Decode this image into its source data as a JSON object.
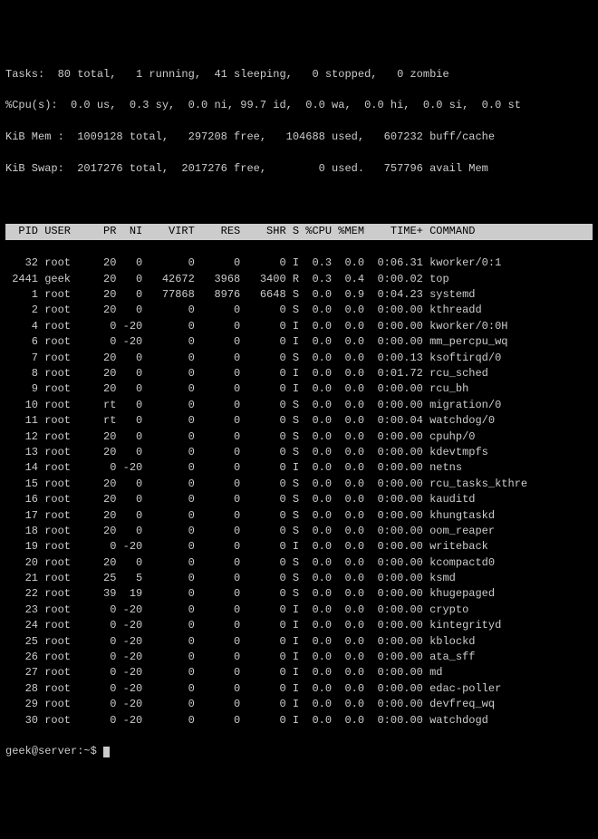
{
  "summary": {
    "tasks_line": "Tasks:  80 total,   1 running,  41 sleeping,   0 stopped,   0 zombie",
    "cpu_line": "%Cpu(s):  0.0 us,  0.3 sy,  0.0 ni, 99.7 id,  0.0 wa,  0.0 hi,  0.0 si,  0.0 st",
    "mem_line": "KiB Mem :  1009128 total,   297208 free,   104688 used,   607232 buff/cache",
    "swap_line": "KiB Swap:  2017276 total,  2017276 free,        0 used.   757796 avail Mem"
  },
  "columns": [
    "PID",
    "USER",
    "PR",
    "NI",
    "VIRT",
    "RES",
    "SHR",
    "S",
    "%CPU",
    "%MEM",
    "TIME+",
    "COMMAND"
  ],
  "processes": [
    {
      "pid": 32,
      "user": "root",
      "pr": "20",
      "ni": "0",
      "virt": "0",
      "res": "0",
      "shr": "0",
      "s": "I",
      "cpu": "0.3",
      "mem": "0.0",
      "time": "0:06.31",
      "cmd": "kworker/0:1"
    },
    {
      "pid": 2441,
      "user": "geek",
      "pr": "20",
      "ni": "0",
      "virt": "42672",
      "res": "3968",
      "shr": "3400",
      "s": "R",
      "cpu": "0.3",
      "mem": "0.4",
      "time": "0:00.02",
      "cmd": "top"
    },
    {
      "pid": 1,
      "user": "root",
      "pr": "20",
      "ni": "0",
      "virt": "77868",
      "res": "8976",
      "shr": "6648",
      "s": "S",
      "cpu": "0.0",
      "mem": "0.9",
      "time": "0:04.23",
      "cmd": "systemd"
    },
    {
      "pid": 2,
      "user": "root",
      "pr": "20",
      "ni": "0",
      "virt": "0",
      "res": "0",
      "shr": "0",
      "s": "S",
      "cpu": "0.0",
      "mem": "0.0",
      "time": "0:00.00",
      "cmd": "kthreadd"
    },
    {
      "pid": 4,
      "user": "root",
      "pr": "0",
      "ni": "-20",
      "virt": "0",
      "res": "0",
      "shr": "0",
      "s": "I",
      "cpu": "0.0",
      "mem": "0.0",
      "time": "0:00.00",
      "cmd": "kworker/0:0H"
    },
    {
      "pid": 6,
      "user": "root",
      "pr": "0",
      "ni": "-20",
      "virt": "0",
      "res": "0",
      "shr": "0",
      "s": "I",
      "cpu": "0.0",
      "mem": "0.0",
      "time": "0:00.00",
      "cmd": "mm_percpu_wq"
    },
    {
      "pid": 7,
      "user": "root",
      "pr": "20",
      "ni": "0",
      "virt": "0",
      "res": "0",
      "shr": "0",
      "s": "S",
      "cpu": "0.0",
      "mem": "0.0",
      "time": "0:00.13",
      "cmd": "ksoftirqd/0"
    },
    {
      "pid": 8,
      "user": "root",
      "pr": "20",
      "ni": "0",
      "virt": "0",
      "res": "0",
      "shr": "0",
      "s": "I",
      "cpu": "0.0",
      "mem": "0.0",
      "time": "0:01.72",
      "cmd": "rcu_sched"
    },
    {
      "pid": 9,
      "user": "root",
      "pr": "20",
      "ni": "0",
      "virt": "0",
      "res": "0",
      "shr": "0",
      "s": "I",
      "cpu": "0.0",
      "mem": "0.0",
      "time": "0:00.00",
      "cmd": "rcu_bh"
    },
    {
      "pid": 10,
      "user": "root",
      "pr": "rt",
      "ni": "0",
      "virt": "0",
      "res": "0",
      "shr": "0",
      "s": "S",
      "cpu": "0.0",
      "mem": "0.0",
      "time": "0:00.00",
      "cmd": "migration/0"
    },
    {
      "pid": 11,
      "user": "root",
      "pr": "rt",
      "ni": "0",
      "virt": "0",
      "res": "0",
      "shr": "0",
      "s": "S",
      "cpu": "0.0",
      "mem": "0.0",
      "time": "0:00.04",
      "cmd": "watchdog/0"
    },
    {
      "pid": 12,
      "user": "root",
      "pr": "20",
      "ni": "0",
      "virt": "0",
      "res": "0",
      "shr": "0",
      "s": "S",
      "cpu": "0.0",
      "mem": "0.0",
      "time": "0:00.00",
      "cmd": "cpuhp/0"
    },
    {
      "pid": 13,
      "user": "root",
      "pr": "20",
      "ni": "0",
      "virt": "0",
      "res": "0",
      "shr": "0",
      "s": "S",
      "cpu": "0.0",
      "mem": "0.0",
      "time": "0:00.00",
      "cmd": "kdevtmpfs"
    },
    {
      "pid": 14,
      "user": "root",
      "pr": "0",
      "ni": "-20",
      "virt": "0",
      "res": "0",
      "shr": "0",
      "s": "I",
      "cpu": "0.0",
      "mem": "0.0",
      "time": "0:00.00",
      "cmd": "netns"
    },
    {
      "pid": 15,
      "user": "root",
      "pr": "20",
      "ni": "0",
      "virt": "0",
      "res": "0",
      "shr": "0",
      "s": "S",
      "cpu": "0.0",
      "mem": "0.0",
      "time": "0:00.00",
      "cmd": "rcu_tasks_kthre"
    },
    {
      "pid": 16,
      "user": "root",
      "pr": "20",
      "ni": "0",
      "virt": "0",
      "res": "0",
      "shr": "0",
      "s": "S",
      "cpu": "0.0",
      "mem": "0.0",
      "time": "0:00.00",
      "cmd": "kauditd"
    },
    {
      "pid": 17,
      "user": "root",
      "pr": "20",
      "ni": "0",
      "virt": "0",
      "res": "0",
      "shr": "0",
      "s": "S",
      "cpu": "0.0",
      "mem": "0.0",
      "time": "0:00.00",
      "cmd": "khungtaskd"
    },
    {
      "pid": 18,
      "user": "root",
      "pr": "20",
      "ni": "0",
      "virt": "0",
      "res": "0",
      "shr": "0",
      "s": "S",
      "cpu": "0.0",
      "mem": "0.0",
      "time": "0:00.00",
      "cmd": "oom_reaper"
    },
    {
      "pid": 19,
      "user": "root",
      "pr": "0",
      "ni": "-20",
      "virt": "0",
      "res": "0",
      "shr": "0",
      "s": "I",
      "cpu": "0.0",
      "mem": "0.0",
      "time": "0:00.00",
      "cmd": "writeback"
    },
    {
      "pid": 20,
      "user": "root",
      "pr": "20",
      "ni": "0",
      "virt": "0",
      "res": "0",
      "shr": "0",
      "s": "S",
      "cpu": "0.0",
      "mem": "0.0",
      "time": "0:00.00",
      "cmd": "kcompactd0"
    },
    {
      "pid": 21,
      "user": "root",
      "pr": "25",
      "ni": "5",
      "virt": "0",
      "res": "0",
      "shr": "0",
      "s": "S",
      "cpu": "0.0",
      "mem": "0.0",
      "time": "0:00.00",
      "cmd": "ksmd"
    },
    {
      "pid": 22,
      "user": "root",
      "pr": "39",
      "ni": "19",
      "virt": "0",
      "res": "0",
      "shr": "0",
      "s": "S",
      "cpu": "0.0",
      "mem": "0.0",
      "time": "0:00.00",
      "cmd": "khugepaged"
    },
    {
      "pid": 23,
      "user": "root",
      "pr": "0",
      "ni": "-20",
      "virt": "0",
      "res": "0",
      "shr": "0",
      "s": "I",
      "cpu": "0.0",
      "mem": "0.0",
      "time": "0:00.00",
      "cmd": "crypto"
    },
    {
      "pid": 24,
      "user": "root",
      "pr": "0",
      "ni": "-20",
      "virt": "0",
      "res": "0",
      "shr": "0",
      "s": "I",
      "cpu": "0.0",
      "mem": "0.0",
      "time": "0:00.00",
      "cmd": "kintegrityd"
    },
    {
      "pid": 25,
      "user": "root",
      "pr": "0",
      "ni": "-20",
      "virt": "0",
      "res": "0",
      "shr": "0",
      "s": "I",
      "cpu": "0.0",
      "mem": "0.0",
      "time": "0:00.00",
      "cmd": "kblockd"
    },
    {
      "pid": 26,
      "user": "root",
      "pr": "0",
      "ni": "-20",
      "virt": "0",
      "res": "0",
      "shr": "0",
      "s": "I",
      "cpu": "0.0",
      "mem": "0.0",
      "time": "0:00.00",
      "cmd": "ata_sff"
    },
    {
      "pid": 27,
      "user": "root",
      "pr": "0",
      "ni": "-20",
      "virt": "0",
      "res": "0",
      "shr": "0",
      "s": "I",
      "cpu": "0.0",
      "mem": "0.0",
      "time": "0:00.00",
      "cmd": "md"
    },
    {
      "pid": 28,
      "user": "root",
      "pr": "0",
      "ni": "-20",
      "virt": "0",
      "res": "0",
      "shr": "0",
      "s": "I",
      "cpu": "0.0",
      "mem": "0.0",
      "time": "0:00.00",
      "cmd": "edac-poller"
    },
    {
      "pid": 29,
      "user": "root",
      "pr": "0",
      "ni": "-20",
      "virt": "0",
      "res": "0",
      "shr": "0",
      "s": "I",
      "cpu": "0.0",
      "mem": "0.0",
      "time": "0:00.00",
      "cmd": "devfreq_wq"
    },
    {
      "pid": 30,
      "user": "root",
      "pr": "0",
      "ni": "-20",
      "virt": "0",
      "res": "0",
      "shr": "0",
      "s": "I",
      "cpu": "0.0",
      "mem": "0.0",
      "time": "0:00.00",
      "cmd": "watchdogd"
    }
  ],
  "prompt": "geek@server:~$ "
}
